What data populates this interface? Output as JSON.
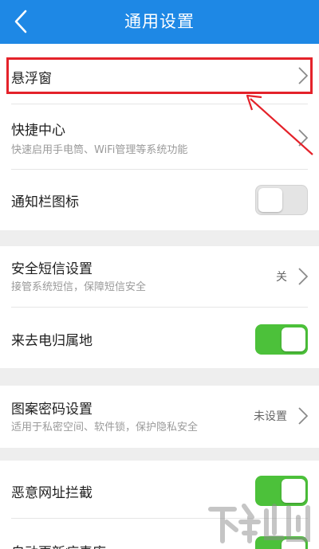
{
  "header": {
    "title": "通用设置",
    "background": "#1e88e5"
  },
  "settings": {
    "floating_window": {
      "label": "悬浮窗"
    },
    "quick_center": {
      "label": "快捷中心",
      "subtitle": "快速启用手电筒、WiFi管理等系统功能"
    },
    "notification_icon": {
      "label": "通知栏图标",
      "toggle": "off"
    },
    "security_sms": {
      "label": "安全短信设置",
      "subtitle": "接管系统短信，保障短信安全",
      "value": "关"
    },
    "caller_location": {
      "label": "来去电归属地",
      "toggle": "on"
    },
    "pattern_password": {
      "label": "图案密码设置",
      "subtitle": "适用于私密空间、软件锁，保护隐私安全",
      "value": "未设置"
    },
    "malicious_url": {
      "label": "恶意网址拦截",
      "toggle": "on"
    },
    "auto_update": {
      "label": "自动更新病毒库",
      "toggle": "on"
    }
  },
  "annotation": {
    "color": "#e4222a"
  },
  "colors": {
    "toggle_on": "#4cc13a",
    "toggle_off": "#e4e4e4"
  }
}
